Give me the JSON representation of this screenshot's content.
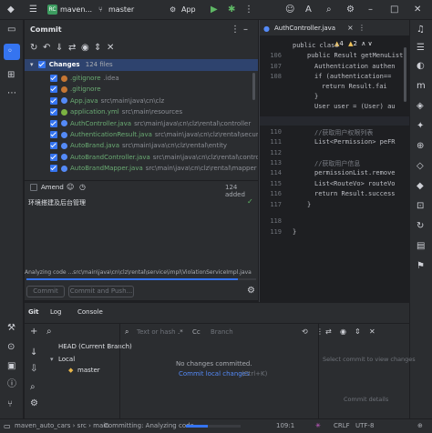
{
  "titlebar": {
    "project_badge": "RC",
    "project_name": "maven...",
    "branch": "master",
    "run_config": "App"
  },
  "commit_panel": {
    "title": "Commit",
    "changes_label": "Changes",
    "changes_count": "124 files",
    "files": [
      {
        "name": ".gitignore",
        "path": ".idea",
        "color": "#c57633"
      },
      {
        "name": ".gitignore",
        "path": "",
        "color": "#c57633"
      },
      {
        "name": "App.java",
        "path": "src\\main\\java\\cn\\clz",
        "color": "#548af7"
      },
      {
        "name": "application.yml",
        "path": "src\\main\\resources",
        "color": "#7cb342"
      },
      {
        "name": "AuthController.java",
        "path": "src\\main\\java\\cn\\clz\\rental\\controller",
        "color": "#548af7"
      },
      {
        "name": "AuthenticationResult.java",
        "path": "src\\main\\java\\cn\\clz\\rental\\security",
        "color": "#548af7"
      },
      {
        "name": "AutoBrand.java",
        "path": "src\\main\\java\\cn\\clz\\rental\\entity",
        "color": "#548af7"
      },
      {
        "name": "AutoBrandController.java",
        "path": "src\\main\\java\\cn\\clz\\rental\\controller",
        "color": "#548af7"
      },
      {
        "name": "AutoBrandMapper.java",
        "path": "src\\main\\java\\cn\\clz\\rental\\mapper",
        "color": "#548af7"
      }
    ],
    "amend_label": "Amend",
    "added_text": "124 added",
    "commit_message": "环境搭建及后台管理",
    "progress_text": "Analyzing code ...src\\main\\java\\cn\\clz\\rental\\service\\impl\\ViolationServiceImpl.java",
    "commit_button": "Commit",
    "commit_push_button": "Commit and Push..."
  },
  "editor": {
    "tab": "AuthController.java",
    "warnings": "4",
    "weak_warnings": "2",
    "lines": [
      {
        "no": "",
        "text": "public class"
      },
      {
        "no": "106",
        "text": "public Result getMenuList"
      },
      {
        "no": "107",
        "text": "Authentication authen"
      },
      {
        "no": "108",
        "text": "if (authentication=="
      },
      {
        "no": "",
        "text": "return Result.fai"
      },
      {
        "no": "",
        "text": "}"
      },
      {
        "no": "",
        "text": "User user = (User) au"
      },
      {
        "no": "109",
        "text": ""
      },
      {
        "no": "110",
        "text": "//获取用户权限列表"
      },
      {
        "no": "111",
        "text": "List<Permission> peFR"
      },
      {
        "no": "112",
        "text": ""
      },
      {
        "no": "113",
        "text": "//获取用户信息"
      },
      {
        "no": "114",
        "text": "permissionList.remove"
      },
      {
        "no": "115",
        "text": "List<RouteVo> routeVo"
      },
      {
        "no": "116",
        "text": "return Result.success"
      },
      {
        "no": "117",
        "text": "}"
      },
      {
        "no": "118",
        "text": ""
      },
      {
        "no": "119",
        "text": "}"
      }
    ]
  },
  "git_panel": {
    "tabs": [
      "Git",
      "Log",
      "Console"
    ],
    "search_placeholder": "Text or hash",
    "branch_filter": "Branch",
    "head_label": "HEAD (Current Branch)",
    "local_label": "Local",
    "master_label": "master",
    "no_changes": "No changes committed.",
    "commit_local_link": "Commit local changes",
    "shortcut": "(Ctrl+K)",
    "select_commit": "Select commit to view changes",
    "commit_details": "Commit details"
  },
  "status_bar": {
    "breadcrumb": [
      "maven_auto_cars",
      "src",
      "main"
    ],
    "task": "Committing: Analyzing code",
    "position": "109:1",
    "line_sep": "CRLF",
    "encoding": "UTF-8"
  },
  "colors": {
    "accent": "#3574f0",
    "bg": "#2b2d30",
    "editor_bg": "#1e1f22"
  }
}
